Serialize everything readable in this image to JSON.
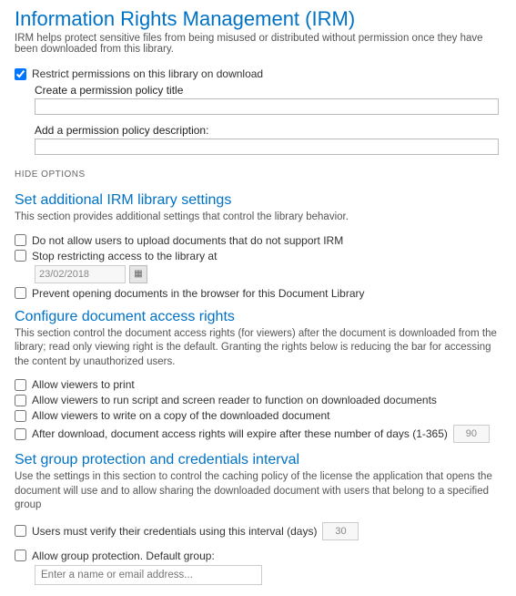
{
  "header": {
    "title": "Information Rights Management (IRM)",
    "subtitle": "IRM helps protect sensitive files from being misused or distributed without permission once they have been downloaded from this library."
  },
  "restrict": {
    "label": "Restrict permissions on this library on download",
    "policy_title_label": "Create a permission policy title",
    "policy_title_value": "",
    "policy_desc_label": "Add a permission policy description:",
    "policy_desc_value": ""
  },
  "hide_options": "HIDE OPTIONS",
  "section_additional": {
    "title": "Set additional IRM library settings",
    "desc": "This section provides additional settings that control the library behavior.",
    "opt_no_upload": "Do not allow users to upload documents that do not support IRM",
    "opt_stop_restrict": "Stop restricting access to the library at",
    "date_value": "23/02/2018",
    "opt_prevent_browser": "Prevent opening documents in the browser for this Document Library"
  },
  "section_access": {
    "title": "Configure document access rights",
    "desc": "This section control the document access rights (for viewers) after the document is downloaded from the library; read only viewing right is the default. Granting the rights below is reducing the bar for accessing the content by unauthorized users.",
    "opt_print": "Allow viewers to print",
    "opt_script": "Allow viewers to run script and screen reader to function on downloaded documents",
    "opt_write": "Allow viewers to write on a copy of the downloaded document",
    "opt_expire": "After download, document access rights will expire after these number of days (1-365)",
    "expire_value": "90"
  },
  "section_group": {
    "title": "Set group protection and credentials interval",
    "desc": "Use the settings in this section to control the caching policy of the license the application that opens the document will use and to allow sharing the downloaded document with users that belong to a specified group",
    "opt_verify": "Users must verify their credentials using this interval (days)",
    "verify_value": "30",
    "opt_group": "Allow group protection. Default group:",
    "group_placeholder": "Enter a name or email address..."
  }
}
